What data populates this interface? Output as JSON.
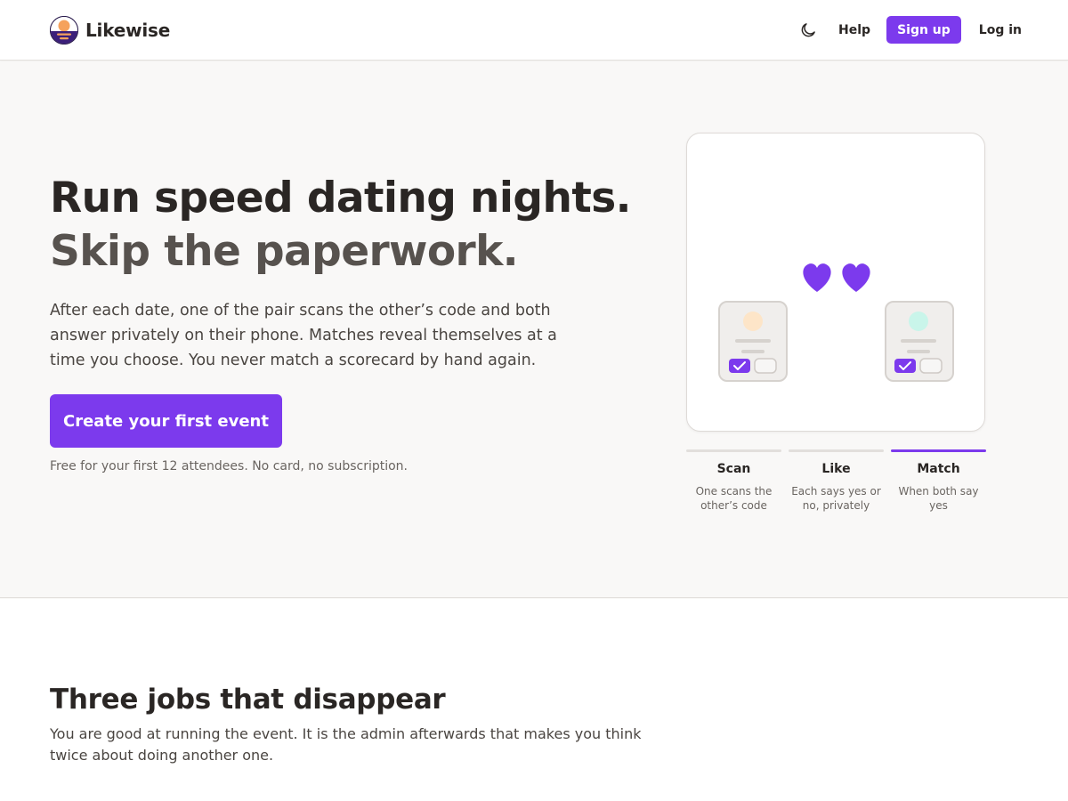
{
  "header": {
    "brand_name": "Likewise",
    "help_label": "Help",
    "signup_label": "Sign up",
    "login_label": "Log in",
    "theme_icon": "moon-icon"
  },
  "hero": {
    "title_line1": "Run speed dating nights.",
    "title_line2": "Skip the paperwork.",
    "description": "After each date, one of the pair scans the other’s code and both answer privately on their phone. Matches reveal themselves at a time you choose. You never match a scorecard by hand again.",
    "cta_label": "Create your first event",
    "note": "Free for your first 12 attendees. No card, no subscription."
  },
  "illustration": {
    "icons": [
      "heart-icon",
      "heart-icon",
      "phone-card",
      "phone-card",
      "check-icon"
    ]
  },
  "steps": [
    {
      "title": "Scan",
      "description": "One scans the other’s code",
      "active": false
    },
    {
      "title": "Like",
      "description": "Each says yes or no, privately",
      "active": false
    },
    {
      "title": "Match",
      "description": "When both say yes",
      "active": true
    }
  ],
  "section": {
    "title": "Three jobs that disappear",
    "description": "You are good at running the event. It is the admin afterwards that makes you think twice about doing another one."
  },
  "colors": {
    "accent": "#7c3aed",
    "page_bg": "#f9f8f7",
    "text": "#2a2624",
    "muted": "#6a6561",
    "avatar_left": "#fde5c8",
    "avatar_right": "#c9f5ea"
  }
}
